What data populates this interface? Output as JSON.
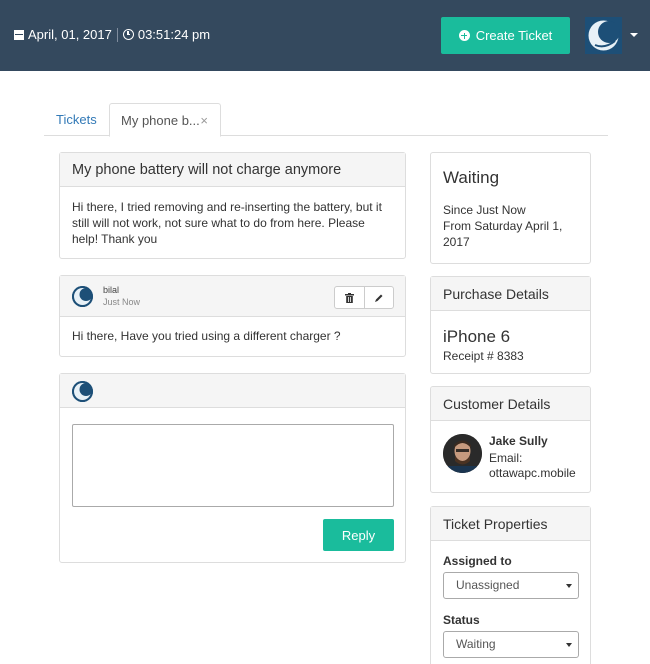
{
  "header": {
    "date": "April, 01, 2017",
    "time": "03:51:24 pm",
    "create_ticket_label": "Create Ticket"
  },
  "tabs": [
    {
      "label": "Tickets"
    },
    {
      "label": "My phone b..."
    }
  ],
  "tab_close": "×",
  "issue": {
    "title": "My phone battery will not charge anymore",
    "body": "Hi there, I tried removing and re-inserting the battery, but it still will not work, not sure what to do from here. Please help! Thank you"
  },
  "reply": {
    "author": "bilal",
    "time": "Just Now",
    "body": "Hi there, Have you tried using a different charger ?"
  },
  "compose": {
    "reply_label": "Reply"
  },
  "status": {
    "title": "Waiting",
    "since": "Since Just Now",
    "from": "From Saturday April 1, 2017"
  },
  "purchase": {
    "heading": "Purchase Details",
    "product": "iPhone 6",
    "receipt": "Receipt # 8383"
  },
  "customer": {
    "heading": "Customer Details",
    "name": "Jake Sully",
    "email_label": "Email:",
    "email": "ottawapc.mobile"
  },
  "properties": {
    "heading": "Ticket Properties",
    "assigned_label": "Assigned to",
    "assigned_value": "Unassigned",
    "status_label": "Status",
    "status_value": "Waiting"
  },
  "colors": {
    "topbar": "#34495e",
    "accent": "#1abc9c",
    "link": "#337ab7"
  }
}
